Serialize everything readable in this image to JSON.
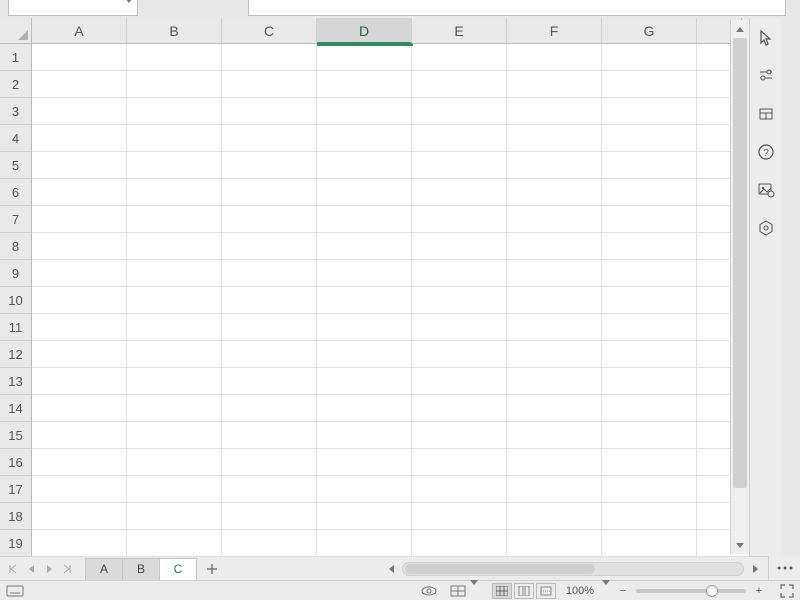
{
  "name_box": "",
  "columns": [
    "A",
    "B",
    "C",
    "D",
    "E",
    "F",
    "G"
  ],
  "rows": [
    "1",
    "2",
    "3",
    "4",
    "5",
    "6",
    "7",
    "8",
    "9",
    "10",
    "11",
    "12",
    "13",
    "14",
    "15",
    "16",
    "17",
    "18",
    "19"
  ],
  "active_column": "D",
  "sheets": [
    {
      "label": "A",
      "active": false
    },
    {
      "label": "B",
      "active": false
    },
    {
      "label": "C",
      "active": true
    }
  ],
  "zoom": {
    "value": "100%",
    "minus": "−",
    "plus": "+"
  },
  "status": {}
}
